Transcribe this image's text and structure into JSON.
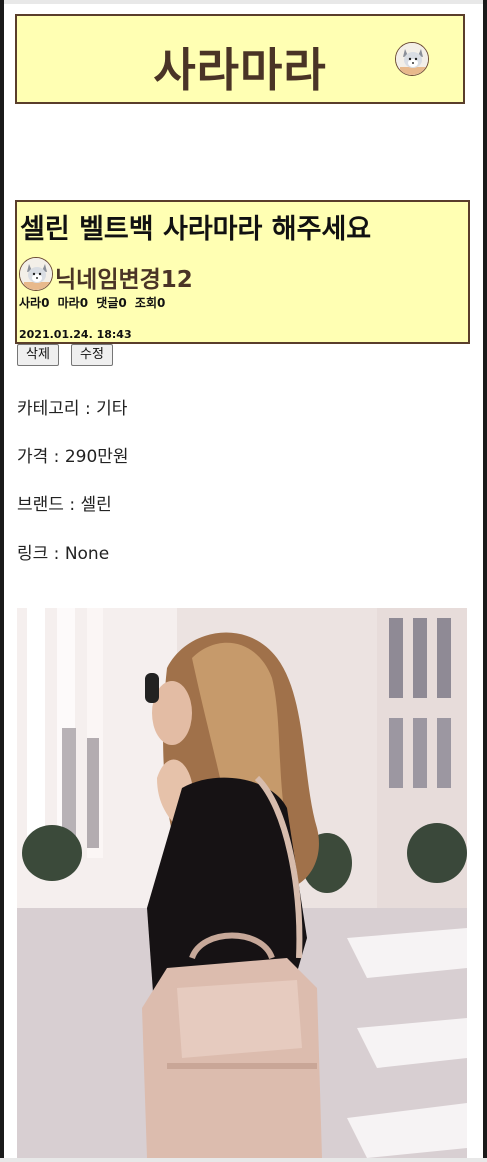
{
  "header": {
    "title": "사라마라"
  },
  "post": {
    "title": "셀린 벨트백 사라마라 해주세요",
    "author": "닉네임변경12",
    "stats": {
      "sara_label": "사라",
      "sara_count": "0",
      "mara_label": "마라",
      "mara_count": "0",
      "comment_label": "댓글",
      "comment_count": "0",
      "view_label": "조회",
      "view_count": "0"
    },
    "date": "2021.01.24. 18:43"
  },
  "actions": {
    "delete_label": "삭제",
    "edit_label": "수정"
  },
  "details": {
    "category": "카테고리 : 기타",
    "price": "가격 : 290만원",
    "brand": "브랜드 : 셀린",
    "link": "링크 : None"
  },
  "icons": {
    "header_avatar": "husky-avatar-icon",
    "author_avatar": "husky-avatar-icon"
  },
  "colors": {
    "panel_bg": "#ffffb3",
    "panel_border": "#5a3e2b",
    "brand_text": "#4a3426"
  }
}
